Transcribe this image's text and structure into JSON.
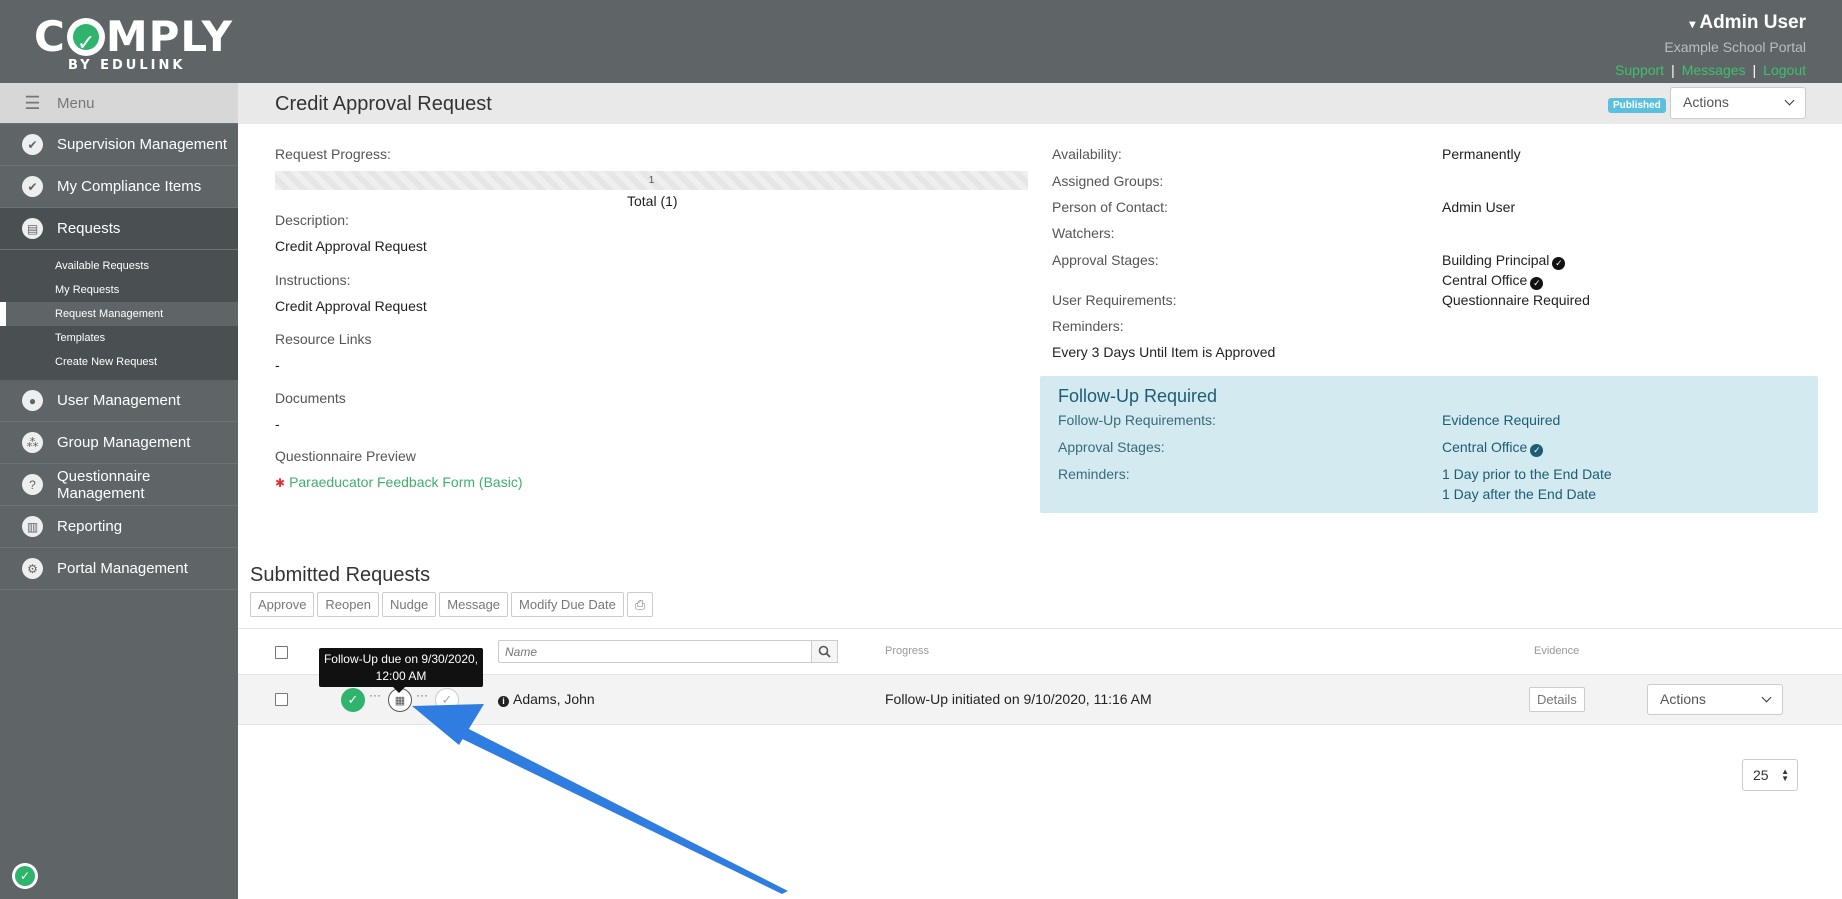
{
  "header": {
    "logo_text": "COMPLY",
    "logo_sub": "BY EDULINK",
    "user_name": "Admin User",
    "portal_name": "Example School Portal",
    "links": [
      "Support",
      "Messages",
      "Logout"
    ]
  },
  "sidebar": {
    "menu_label": "Menu",
    "items": [
      {
        "label": "Supervision Management",
        "icon": "check-circle-icon"
      },
      {
        "label": "My Compliance Items",
        "icon": "check-icon"
      },
      {
        "label": "Requests",
        "icon": "file-icon"
      },
      {
        "label": "User Management",
        "icon": "user-icon"
      },
      {
        "label": "Group Management",
        "icon": "group-icon"
      },
      {
        "label": "Questionnaire Management",
        "icon": "question-icon"
      },
      {
        "label": "Reporting",
        "icon": "chart-icon"
      },
      {
        "label": "Portal Management",
        "icon": "gear-icon"
      }
    ],
    "subitems": [
      "Available Requests",
      "My Requests",
      "Request Management",
      "Templates",
      "Create New Request"
    ],
    "active_subitem": "Request Management"
  },
  "titlebar": {
    "title": "Credit Approval Request",
    "status_badge": "Published",
    "actions_label": "Actions"
  },
  "details": {
    "request_progress_label": "Request Progress:",
    "progress_count": "1",
    "progress_total": "Total (1)",
    "description_label": "Description:",
    "description_value": "Credit Approval Request",
    "instructions_label": "Instructions:",
    "instructions_value": "Credit Approval Request",
    "resource_links_label": "Resource Links",
    "resource_links_value": "-",
    "documents_label": "Documents",
    "documents_value": "-",
    "questionnaire_label": "Questionnaire Preview",
    "questionnaire_value": "Paraeducator Feedback Form (Basic)",
    "availability_label": "Availability:",
    "availability_value": "Permanently",
    "assigned_groups_label": "Assigned Groups:",
    "poc_label": "Person of Contact:",
    "poc_value": "Admin User",
    "watchers_label": "Watchers:",
    "approval_label": "Approval Stages:",
    "approval_values": [
      "Building Principal",
      "Central Office"
    ],
    "user_req_label": "User Requirements:",
    "user_req_value": "Questionnaire Required",
    "reminders_label": "Reminders:",
    "reminders_value": "Every 3 Days Until Item is Approved"
  },
  "followup": {
    "title": "Follow-Up Required",
    "requirements_label": "Follow-Up Requirements:",
    "requirements_value": "Evidence Required",
    "approval_label": "Approval Stages:",
    "approval_value": "Central Office",
    "reminders_label": "Reminders:",
    "reminders_values": [
      "1 Day prior to the End Date",
      "1 Day after the End Date"
    ]
  },
  "submitted": {
    "title": "Submitted Requests",
    "buttons": [
      "Approve",
      "Reopen",
      "Nudge",
      "Message",
      "Modify Due Date"
    ],
    "search_placeholder": "Name",
    "col_progress": "Progress",
    "col_evidence": "Evidence",
    "row": {
      "name": "Adams, John",
      "progress": "Follow-Up initiated on 9/10/2020, 11:16 AM",
      "details_label": "Details",
      "actions_label": "Actions"
    },
    "tooltip": "Follow-Up due on 9/30/2020, 12:00 AM",
    "page_size": "25"
  }
}
